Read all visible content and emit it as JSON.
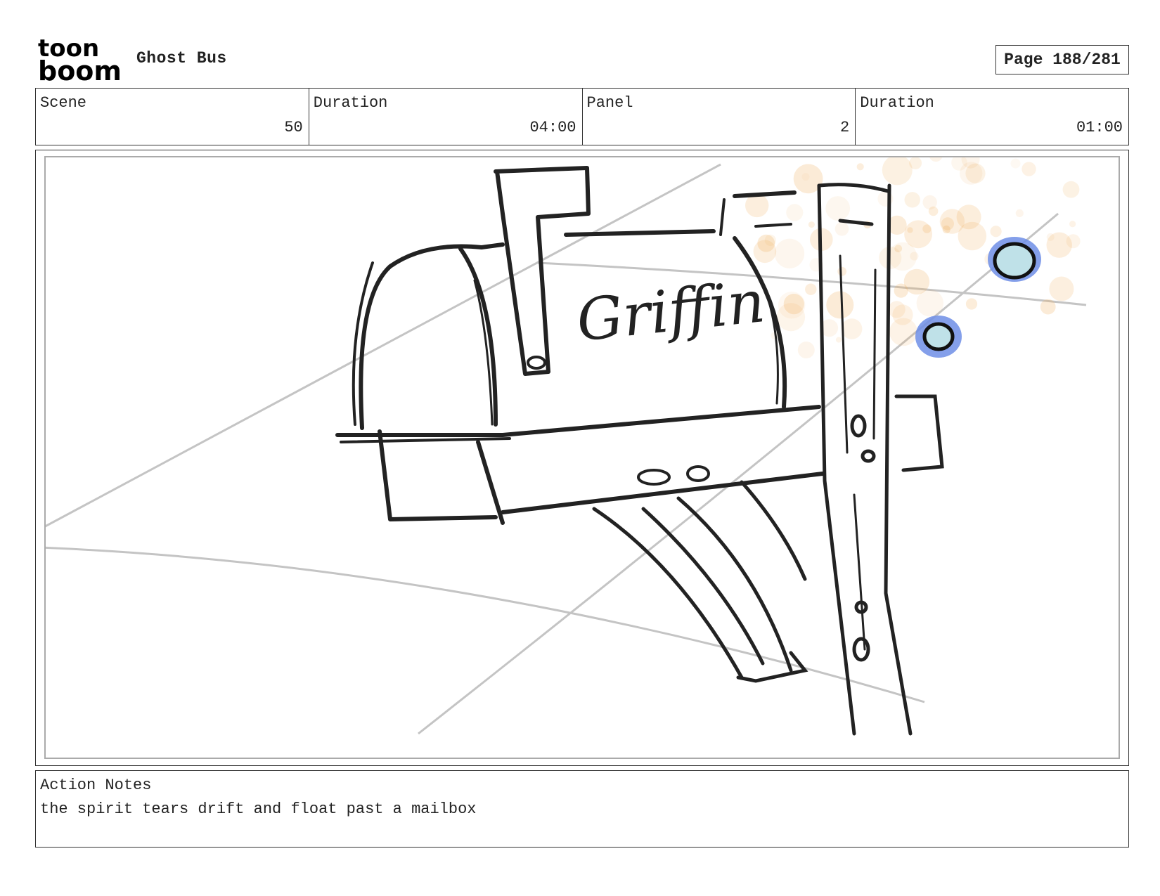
{
  "header": {
    "logo_top": "toon",
    "logo_bottom": "boom",
    "project_title": "Ghost Bus",
    "page_label": "Page 188/281"
  },
  "info": {
    "scene_label": "Scene",
    "scene_value": "50",
    "scene_duration_label": "Duration",
    "scene_duration_value": "04:00",
    "panel_label": "Panel",
    "panel_value": "2",
    "panel_duration_label": "Duration",
    "panel_duration_value": "01:00"
  },
  "panel": {
    "mailbox_name": "Griffin",
    "tear_fill": "#bfe1e8",
    "tear_glow": "#6f8ee6",
    "sparkle_color": "#f0b060"
  },
  "notes": {
    "label": "Action Notes",
    "text": "the spirit tears drift and float past a mailbox"
  }
}
